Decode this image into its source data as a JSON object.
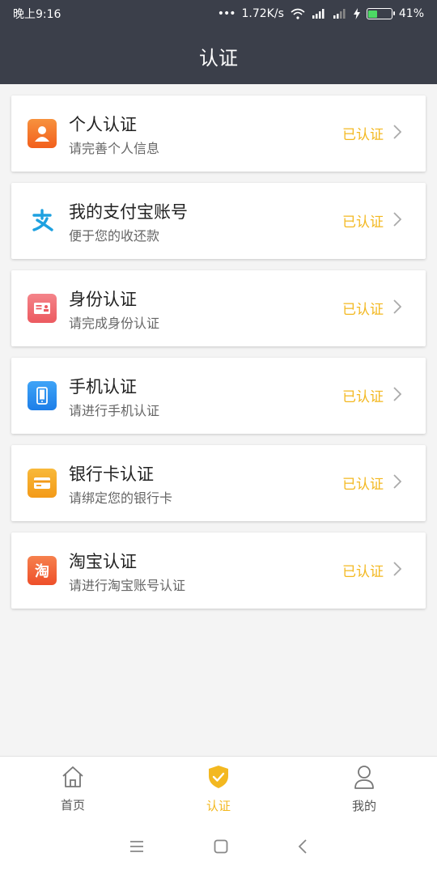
{
  "status_bar": {
    "time": "晚上9:16",
    "dots": "•••",
    "speed": "1.72K/s",
    "battery": "41%",
    "battery_level": 0.41,
    "icons": [
      "wifi-icon",
      "signal-icon",
      "signal-icon",
      "charging-icon",
      "battery-icon"
    ]
  },
  "header": {
    "title": "认证"
  },
  "items": [
    {
      "title": "个人认证",
      "subtitle": "请完善个人信息",
      "status": "已认证",
      "icon": "person-icon",
      "color": "#f47a2a"
    },
    {
      "title": "我的支付宝账号",
      "subtitle": "便于您的收还款",
      "status": "已认证",
      "icon": "alipay-icon",
      "color": "#1ea1e0"
    },
    {
      "title": "身份认证",
      "subtitle": "请完成身份认证",
      "status": "已认证",
      "icon": "id-card-icon",
      "color": "#f06a6f"
    },
    {
      "title": "手机认证",
      "subtitle": "请进行手机认证",
      "status": "已认证",
      "icon": "phone-icon",
      "color": "#2c8ef0"
    },
    {
      "title": "银行卡认证",
      "subtitle": "请绑定您的银行卡",
      "status": "已认证",
      "icon": "bank-card-icon",
      "color": "#f6a623"
    },
    {
      "title": "淘宝认证",
      "subtitle": "请进行淘宝账号认证",
      "status": "已认证",
      "icon": "taobao-icon",
      "glyph": "淘",
      "color": "#f2653b"
    }
  ],
  "tabs": [
    {
      "label": "首页",
      "icon": "home-icon",
      "active": false
    },
    {
      "label": "认证",
      "icon": "shield-check-icon",
      "active": true
    },
    {
      "label": "我的",
      "icon": "user-icon",
      "active": false
    }
  ],
  "colors": {
    "header_bg": "#3b3f4a",
    "accent": "#f3b820"
  },
  "system_nav": [
    "menu-icon",
    "home-square-icon",
    "back-icon"
  ]
}
